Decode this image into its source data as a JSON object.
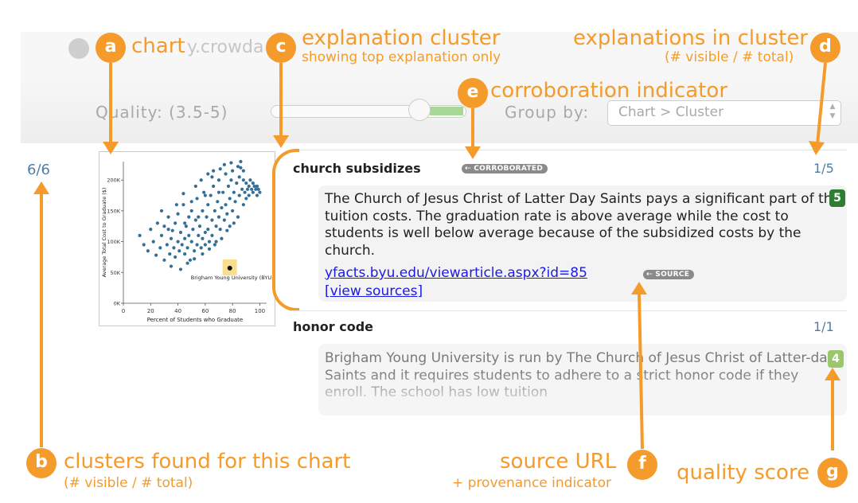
{
  "browser": {
    "url_fragment": "y.crowda"
  },
  "toolbar": {
    "quality_label": "Quality:",
    "quality_range": "(3.5-5)",
    "group_by_label": "Group by:",
    "group_by_value": "Chart > Cluster"
  },
  "cluster_count": "6/6",
  "clusters": [
    {
      "title": "church subsidizes",
      "badge": "CORROBORATED",
      "count": "1/5",
      "score": "5",
      "text": "The Church of Jesus Christ of Latter Day Saints pays a significant part of the tuition costs. The graduation rate is above average while the cost to students is well below average because of the subsidized costs by the church.",
      "link": "yfacts.byu.edu/viewarticle.aspx?id=85",
      "source_badge": "SOURCE",
      "view_sources": "[view sources]"
    },
    {
      "title": "honor code",
      "count": "1/1",
      "score": "4",
      "text": "Brigham Young University is run by The Church of Jesus Christ of Latter-day Saints and it requires students to adhere to a strict honor code if they enroll. The school has low tuition"
    }
  ],
  "annotations": {
    "a": {
      "letter": "a",
      "label": "chart"
    },
    "b": {
      "letter": "b",
      "label": "clusters found for this chart",
      "sub": "(# visible / # total)"
    },
    "c": {
      "letter": "c",
      "label": "explanation cluster",
      "sub": "showing top explanation only"
    },
    "d": {
      "letter": "d",
      "label": "explanations in cluster",
      "sub": "(# visible / # total)"
    },
    "e": {
      "letter": "e",
      "label": "corroboration indicator"
    },
    "f": {
      "letter": "f",
      "label": "source URL",
      "sub": "+ provenance indicator"
    },
    "g": {
      "letter": "g",
      "label": "quality score"
    }
  },
  "chart_data": {
    "type": "scatter",
    "title": "",
    "xlabel": "Percent of Students who Graduate",
    "ylabel": "Average Total Cost to Graduate ($)",
    "xlim": [
      0,
      105
    ],
    "ylim": [
      0,
      230000
    ],
    "x_ticks": [
      "0",
      "20",
      "40",
      "60",
      "80",
      "100"
    ],
    "y_ticks": [
      "0K",
      "50K",
      "100K",
      "150K",
      "200K"
    ],
    "highlight": {
      "label": "Brigham Young University (BYU)",
      "x": 78,
      "y": 57000
    },
    "series": [
      {
        "values": [
          [
            12,
            110000
          ],
          [
            15,
            95000
          ],
          [
            18,
            85000
          ],
          [
            20,
            120000
          ],
          [
            22,
            100000
          ],
          [
            24,
            78000
          ],
          [
            25,
            130000
          ],
          [
            27,
            90000
          ],
          [
            28,
            110000
          ],
          [
            30,
            70000
          ],
          [
            30,
            125000
          ],
          [
            32,
            95000
          ],
          [
            33,
            140000
          ],
          [
            34,
            80000
          ],
          [
            35,
            105000
          ],
          [
            36,
            118000
          ],
          [
            37,
            90000
          ],
          [
            38,
            130000
          ],
          [
            38,
            75000
          ],
          [
            40,
            100000
          ],
          [
            40,
            145000
          ],
          [
            41,
            85000
          ],
          [
            42,
            115000
          ],
          [
            43,
            95000
          ],
          [
            44,
            160000
          ],
          [
            45,
            105000
          ],
          [
            45,
            80000
          ],
          [
            46,
            125000
          ],
          [
            47,
            90000
          ],
          [
            48,
            140000
          ],
          [
            48,
            110000
          ],
          [
            49,
            70000
          ],
          [
            50,
            100000
          ],
          [
            50,
            150000
          ],
          [
            51,
            120000
          ],
          [
            52,
            85000
          ],
          [
            53,
            135000
          ],
          [
            54,
            95000
          ],
          [
            54,
            170000
          ],
          [
            55,
            110000
          ],
          [
            56,
            125000
          ],
          [
            57,
            90000
          ],
          [
            58,
            150000
          ],
          [
            58,
            105000
          ],
          [
            59,
            180000
          ],
          [
            60,
            115000
          ],
          [
            60,
            95000
          ],
          [
            61,
            140000
          ],
          [
            62,
            160000
          ],
          [
            62,
            120000
          ],
          [
            63,
            100000
          ],
          [
            64,
            175000
          ],
          [
            65,
            135000
          ],
          [
            65,
            110000
          ],
          [
            66,
            190000
          ],
          [
            67,
            150000
          ],
          [
            68,
            125000
          ],
          [
            68,
            100000
          ],
          [
            69,
            165000
          ],
          [
            70,
            140000
          ],
          [
            70,
            200000
          ],
          [
            71,
            120000
          ],
          [
            72,
            155000
          ],
          [
            73,
            180000
          ],
          [
            74,
            135000
          ],
          [
            75,
            210000
          ],
          [
            75,
            160000
          ],
          [
            76,
            145000
          ],
          [
            77,
            190000
          ],
          [
            78,
            125000
          ],
          [
            78,
            170000
          ],
          [
            79,
            200000
          ],
          [
            80,
            150000
          ],
          [
            80,
            215000
          ],
          [
            81,
            180000
          ],
          [
            82,
            165000
          ],
          [
            83,
            195000
          ],
          [
            84,
            140000
          ],
          [
            85,
            205000
          ],
          [
            85,
            175000
          ],
          [
            86,
            220000
          ],
          [
            87,
            185000
          ],
          [
            88,
            160000
          ],
          [
            88,
            200000
          ],
          [
            89,
            180000
          ],
          [
            90,
            195000
          ],
          [
            90,
            170000
          ],
          [
            91,
            185000
          ],
          [
            92,
            190000
          ],
          [
            92,
            175000
          ],
          [
            93,
            200000
          ],
          [
            94,
            185000
          ],
          [
            95,
            180000
          ],
          [
            95,
            195000
          ],
          [
            96,
            190000
          ],
          [
            97,
            185000
          ],
          [
            98,
            175000
          ],
          [
            98,
            190000
          ],
          [
            99,
            185000
          ],
          [
            100,
            180000
          ],
          [
            35,
            60000
          ],
          [
            42,
            55000
          ],
          [
            47,
            65000
          ],
          [
            52,
            72000
          ],
          [
            58,
            80000
          ],
          [
            63,
            88000
          ],
          [
            67,
            95000
          ],
          [
            72,
            105000
          ],
          [
            76,
            118000
          ],
          [
            81,
            130000
          ],
          [
            45,
            130000
          ],
          [
            50,
            165000
          ],
          [
            55,
            140000
          ],
          [
            60,
            175000
          ],
          [
            65,
            205000
          ],
          [
            70,
            180000
          ],
          [
            74,
            225000
          ],
          [
            79,
            228000
          ],
          [
            84,
            222000
          ],
          [
            88,
            215000
          ],
          [
            28,
            150000
          ],
          [
            33,
            120000
          ],
          [
            39,
            160000
          ],
          [
            44,
            178000
          ],
          [
            53,
            190000
          ],
          [
            57,
            200000
          ],
          [
            62,
            210000
          ],
          [
            66,
            215000
          ],
          [
            71,
            218000
          ],
          [
            86,
            230000
          ]
        ]
      }
    ]
  }
}
